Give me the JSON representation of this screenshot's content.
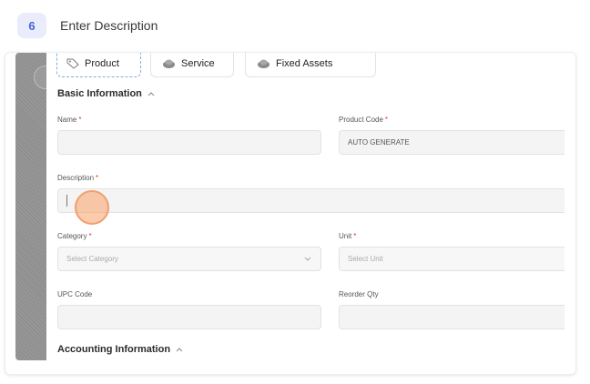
{
  "step": {
    "number": "6",
    "instruction": "Enter Description"
  },
  "item_type_tabs": [
    {
      "label": "Product",
      "icon": "product-tag-icon",
      "active": true
    },
    {
      "label": "Service",
      "icon": "service-cloud-icon",
      "active": false
    },
    {
      "label": "Fixed Assets",
      "icon": "fixed-assets-cloud-icon",
      "active": false
    }
  ],
  "form": {
    "basic_section_title": "Basic Information",
    "name": {
      "label": "Name",
      "required_mark": "*",
      "value": ""
    },
    "product_code": {
      "label": "Product Code",
      "required_mark": "*",
      "value": "AUTO GENERATE"
    },
    "description": {
      "label": "Description",
      "required_mark": "*",
      "value": ""
    },
    "category": {
      "label": "Category",
      "required_mark": "*",
      "placeholder": "Select Category"
    },
    "unit": {
      "label": "Unit",
      "required_mark": "*",
      "placeholder": "Select Unit"
    },
    "upc_code": {
      "label": "UPC Code",
      "value": ""
    },
    "reorder_qty": {
      "label": "Reorder Qty",
      "value": ""
    },
    "accounting_section_title": "Accounting Information"
  },
  "colors": {
    "accent": "#4a63d6",
    "required": "#e53935",
    "click_marker": "#f0a070"
  }
}
